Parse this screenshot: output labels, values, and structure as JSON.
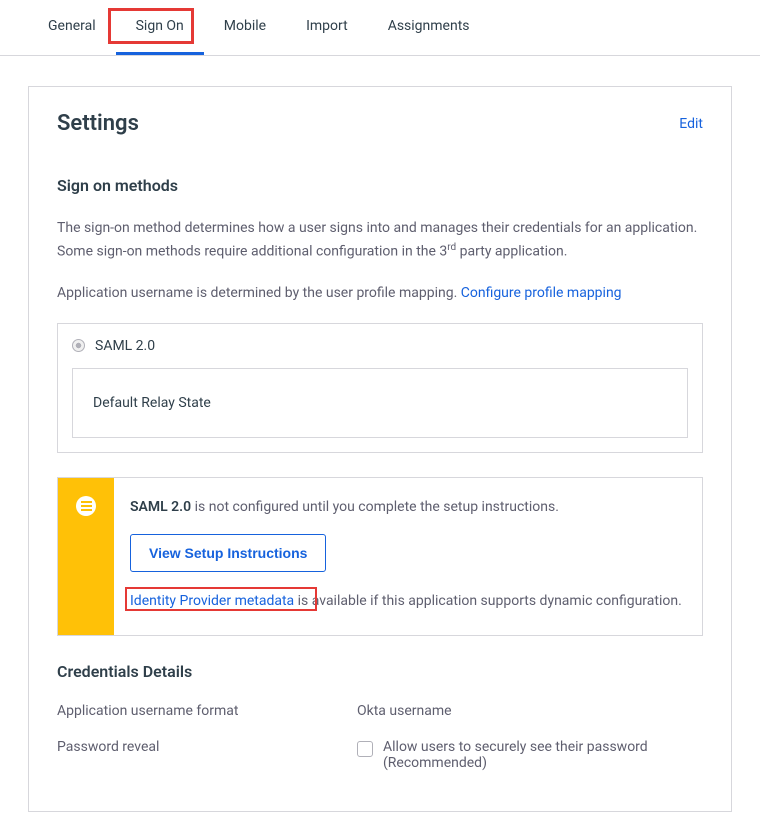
{
  "tabs": {
    "general": "General",
    "signon": "Sign On",
    "mobile": "Mobile",
    "import": "Import",
    "assignments": "Assignments",
    "active": "signon"
  },
  "card": {
    "title": "Settings",
    "edit": "Edit"
  },
  "signon_section": {
    "title": "Sign on methods",
    "desc_part1": "The sign-on method determines how a user signs into and manages their credentials for an application. Some sign-on methods require additional configuration in the 3",
    "desc_sup": "rd",
    "desc_part2": " party application.",
    "desc_line2_prefix": "Application username is determined by the user profile mapping. ",
    "desc_line2_link": "Configure profile mapping",
    "saml_label": "SAML 2.0",
    "relay_label": "Default Relay State"
  },
  "notice": {
    "bold": "SAML 2.0",
    "line1_rest": " is not configured until you complete the setup instructions.",
    "button": "View Setup Instructions",
    "idp_link": "Identity Provider metadata",
    "idp_rest": " is available if this application supports dynamic configuration."
  },
  "credentials": {
    "title": "Credentials Details",
    "username_format_label": "Application username format",
    "username_format_value": "Okta username",
    "password_reveal_label": "Password reveal",
    "password_reveal_value": "Allow users to securely see their password (Recommended)"
  }
}
